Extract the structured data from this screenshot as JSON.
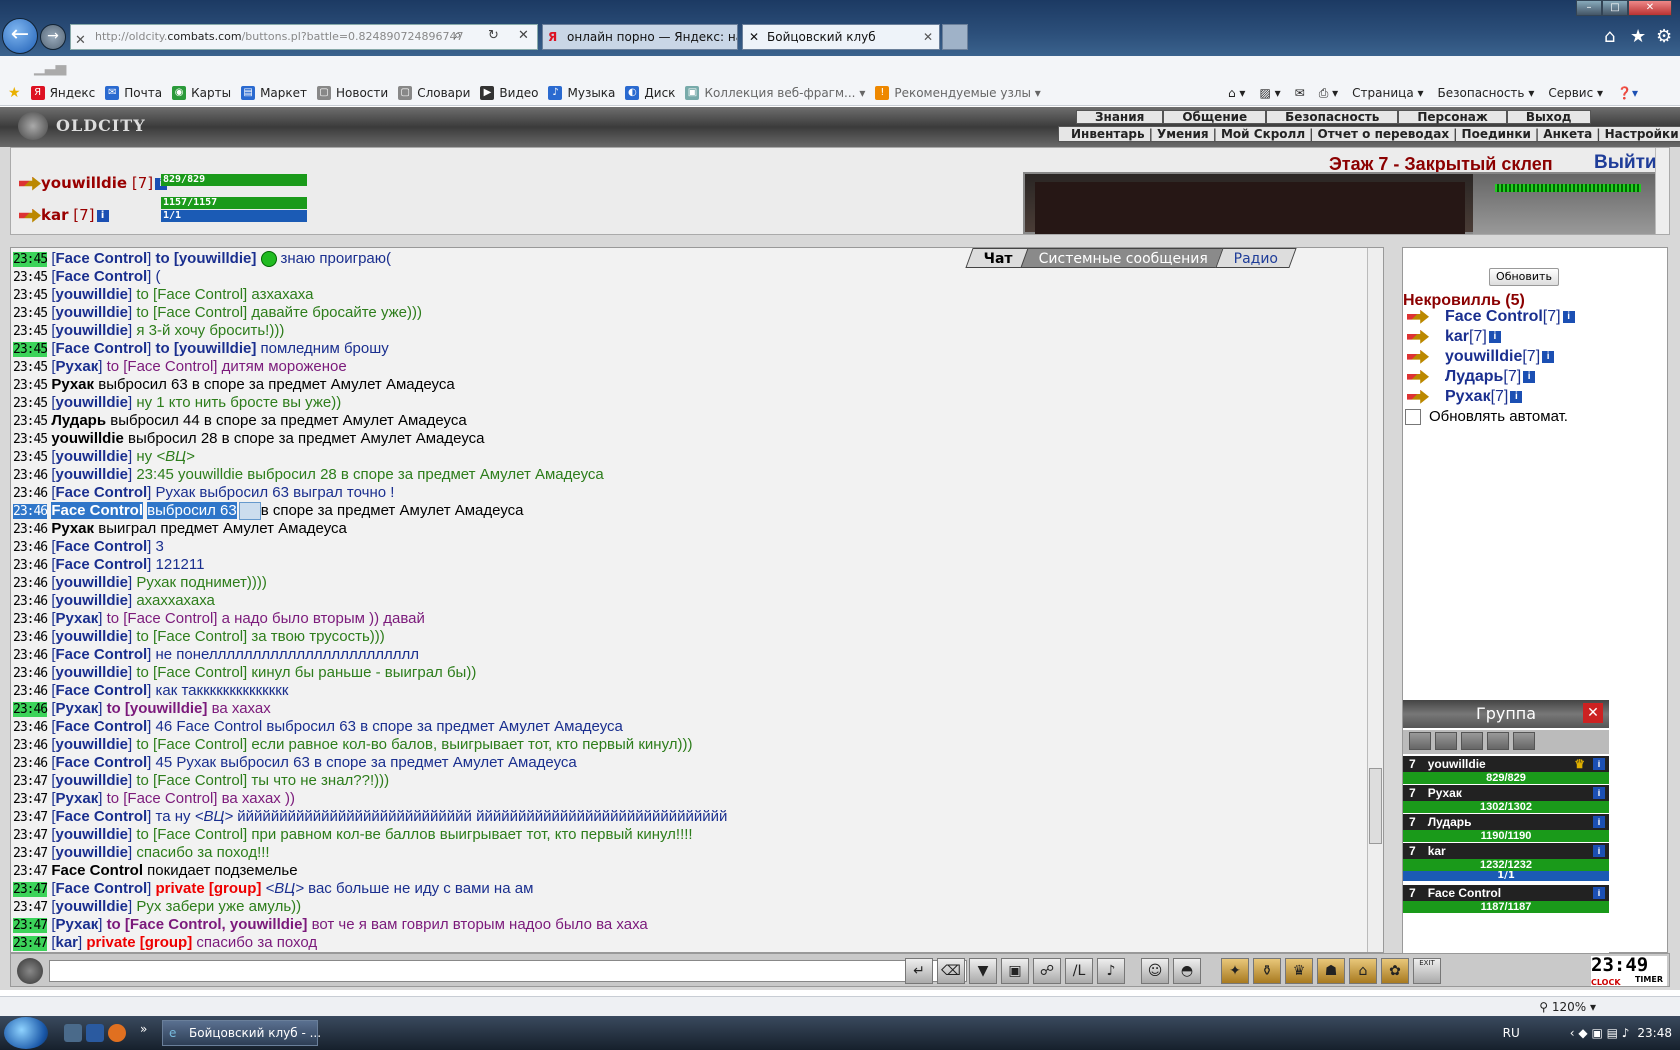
{
  "browser": {
    "url_prefix": "http://oldcity.",
    "url_domain": "combats.com",
    "url_rest": "/buttons.pl?battle=0.824890724896747",
    "tabs": [
      {
        "label": "онлайн порно — Яндекс: на..."
      },
      {
        "label": "Бойцовский клуб"
      }
    ],
    "favorites": [
      {
        "label": "Яндекс",
        "color": "#d12"
      },
      {
        "label": "Почта",
        "color": "#2a6ad0"
      },
      {
        "label": "Карты",
        "color": "#2a9a3a"
      },
      {
        "label": "Маркет",
        "color": "#2a6ad0"
      },
      {
        "label": "Новости",
        "color": "#888"
      },
      {
        "label": "Словари",
        "color": "#888"
      },
      {
        "label": "Видео",
        "color": "#333"
      },
      {
        "label": "Музыка",
        "color": "#2a6ad0"
      },
      {
        "label": "Диск",
        "color": "#2a6ad0"
      },
      {
        "label": "Коллекция веб-фрагм...",
        "color": "#7aa"
      },
      {
        "label": "Рекомендуемые узлы",
        "color": "#e80"
      }
    ],
    "commands": [
      "Страница ▾",
      "Безопасность ▾",
      "Сервис ▾"
    ],
    "zoom": "120%"
  },
  "game": {
    "logo": "OLDCITY",
    "menu_top": [
      "Знания",
      "Общение",
      "Безопасность",
      "Персонаж",
      "Выход"
    ],
    "menu_sub": [
      "Инвентарь",
      "Умения",
      "Мой Скролл",
      "Отчет о переводах",
      "Поединки",
      "Анкета",
      "Настройки"
    ],
    "location": "Этаж 7 - Закрытый склеп",
    "exit_label": "Выйти",
    "players": [
      {
        "name": "youwilldie",
        "level": "[7]",
        "hp": "829/829",
        "hp_fill": 1.0
      },
      {
        "name": "kar",
        "level": "[7]",
        "hp": "1157/1157",
        "hp_fill": 1.0,
        "mp": "1/1",
        "mp_fill": 1.0
      }
    ]
  },
  "chat": {
    "tabs": [
      "Чат",
      "Системные сообщения",
      "Радио"
    ],
    "lines": [
      {
        "time": "23:45",
        "hl": true,
        "nick": "Face Control",
        "to": "to [youwilldie]",
        "text": "знаю проиграю(",
        "cls": "msg-b",
        "icon": true
      },
      {
        "time": "23:45",
        "nick": "Face Control",
        "text": "(",
        "cls": "msg-b"
      },
      {
        "time": "23:45",
        "nick": "youwilldie",
        "to_plain": "to [Face Control]",
        "text": "азхахаха",
        "cls": "msg-g"
      },
      {
        "time": "23:45",
        "nick": "youwilldie",
        "to_plain": "to [Face Control]",
        "text": "давайте бросайте уже)))",
        "cls": "msg-g"
      },
      {
        "time": "23:45",
        "nick": "youwilldie",
        "text": "я 3-й хочу бросить!)))",
        "cls": "msg-g"
      },
      {
        "time": "23:45",
        "hl": true,
        "nick": "Face Control",
        "to": "to [youwilldie]",
        "text": "помледним брошу",
        "cls": "msg-b"
      },
      {
        "time": "23:45",
        "nick": "Рухак",
        "to_plain": "to [Face Control]",
        "text": "дитям мороженое",
        "cls": "msg-p"
      },
      {
        "time": "23:45",
        "sys": "Рухак",
        "text": "выбросил 63 в споре за предмет Амулет Амадеуса"
      },
      {
        "time": "23:45",
        "nick": "youwilldie",
        "text": "ну 1 кто нить бросте вы уже))",
        "cls": "msg-g"
      },
      {
        "time": "23:45",
        "sys": "Лударь",
        "text": "выбросил 44 в споре за предмет Амулет Амадеуса"
      },
      {
        "time": "23:45",
        "sys": "youwilldie",
        "text": "выбросил 28 в споре за предмет Амулет Амадеуса"
      },
      {
        "time": "23:45",
        "nick": "youwilldie",
        "text": "ну",
        "vc": "<ВЦ>",
        "cls": "msg-g"
      },
      {
        "time": "23:46",
        "nick": "youwilldie",
        "text": "23:45 youwilldie выбросил 28 в споре за предмет Амулет Амадеуса",
        "cls": "msg-g"
      },
      {
        "time": "23:46",
        "nick": "Face Control",
        "text": "Рухак выбросил 63 выграл точно !",
        "cls": "msg-b"
      },
      {
        "time": "23:46",
        "sel": true,
        "sys": "Face Control",
        "seltext": "выбросил 63",
        "text": "в споре за предмет Амулет Амадеуса"
      },
      {
        "time": "23:46",
        "sys": "Рухак",
        "text": "выиграл предмет Амулет Амадеуса"
      },
      {
        "time": "23:46",
        "nick": "Face Control",
        "text": "3",
        "cls": "msg-b"
      },
      {
        "time": "23:46",
        "nick": "Face Control",
        "text": "121211",
        "cls": "msg-b"
      },
      {
        "time": "23:46",
        "nick": "youwilldie",
        "text": "Рухак поднимет))))",
        "cls": "msg-g"
      },
      {
        "time": "23:46",
        "nick": "youwilldie",
        "text": "ахаххахаха",
        "cls": "msg-g"
      },
      {
        "time": "23:46",
        "nick": "Рухак",
        "to_plain": "to [Face Control]",
        "text": "а надо было вторым )) давай",
        "cls": "msg-p"
      },
      {
        "time": "23:46",
        "nick": "youwilldie",
        "to_plain": "to [Face Control]",
        "text": "за твою трусость)))",
        "cls": "msg-g"
      },
      {
        "time": "23:46",
        "nick": "Face Control",
        "text": "не понелллллллллллллллллллллллл",
        "cls": "msg-b"
      },
      {
        "time": "23:46",
        "nick": "youwilldie",
        "to_plain": "to [Face Control]",
        "text": "кинул бы раньше - выиграл бы))",
        "cls": "msg-g"
      },
      {
        "time": "23:46",
        "nick": "Face Control",
        "text": "как такккккккккккккк",
        "cls": "msg-b"
      },
      {
        "time": "23:46",
        "hl": true,
        "nick": "Рухак",
        "to": "to [youwilldie]",
        "text": "ва хахах",
        "cls": "msg-p"
      },
      {
        "time": "23:46",
        "nick": "Face Control",
        "text": "46 Face Control выбросил 63 в споре за предмет Амулет Амадеуса",
        "cls": "msg-b"
      },
      {
        "time": "23:46",
        "nick": "youwilldie",
        "to_plain": "to [Face Control]",
        "text": "если равное кол-во балов, выигрывает тот, кто первый кинул)))",
        "cls": "msg-g"
      },
      {
        "time": "23:46",
        "nick": "Face Control",
        "text": "45 Рухак выбросил 63 в споре за предмет Амулет Амадеуса",
        "cls": "msg-b"
      },
      {
        "time": "23:47",
        "nick": "youwilldie",
        "to_plain": "to [Face Control]",
        "text": "ты что не знал??!)))",
        "cls": "msg-g"
      },
      {
        "time": "23:47",
        "nick": "Рухак",
        "to_plain": "to [Face Control]",
        "text": "ва хахах ))",
        "cls": "msg-p"
      },
      {
        "time": "23:47",
        "nick": "Face Control",
        "text": "та ну",
        "vc": "<ВЦ>",
        "text2": "йййййййййййййййййййййййййййй йййййййййййййййййййййййййййййй",
        "cls": "msg-b"
      },
      {
        "time": "23:47",
        "nick": "youwilldie",
        "to_plain": "to [Face Control]",
        "text": "при равном кол-ве баллов выигрывает тот, кто первый кинул!!!!",
        "cls": "msg-g"
      },
      {
        "time": "23:47",
        "nick": "youwilldie",
        "text": "спасибо за поход!!!",
        "cls": "msg-g"
      },
      {
        "time": "23:47",
        "sys": "Face Control",
        "text": "покидает подземелье"
      },
      {
        "time": "23:47",
        "hl": true,
        "nick": "Face Control",
        "priv": "private [group]",
        "vc": "<ВЦ>",
        "text2": "вас больше не иду с вами на ам",
        "cls": "msg-b"
      },
      {
        "time": "23:47",
        "nick": "youwilldie",
        "text": "Рух забери уже амуль))",
        "cls": "msg-g"
      },
      {
        "time": "23:47",
        "hl": true,
        "nick": "Рухак",
        "to": "to [Face Control, youwilldie]",
        "text": "вот че я вам говрил вторым надоо было ва хаха",
        "cls": "msg-p"
      },
      {
        "time": "23:47",
        "hl": true,
        "nick": "kar",
        "priv": "private [group]",
        "text": "спасибо за поход",
        "cls": "msg-p"
      }
    ]
  },
  "room": {
    "refresh_label": "Обновить",
    "title": "Некровилль (5)",
    "members": [
      {
        "name": "Face Control",
        "level": "[7]"
      },
      {
        "name": "kar",
        "level": "[7]"
      },
      {
        "name": "youwilldie",
        "level": "[7]"
      },
      {
        "name": "Лударь",
        "level": "[7]"
      },
      {
        "name": "Рухак",
        "level": "[7]"
      }
    ],
    "auto_label": "Обновлять автомат."
  },
  "group": {
    "title": "Группа",
    "members": [
      {
        "level": "7",
        "name": "youwilldie",
        "hp": "829/829",
        "leader": true
      },
      {
        "level": "7",
        "name": "Рухак",
        "hp": "1302/1302"
      },
      {
        "level": "7",
        "name": "Лударь",
        "hp": "1190/1190"
      },
      {
        "level": "7",
        "name": "kar",
        "hp": "1232/1232",
        "mp": "1/1"
      },
      {
        "level": "7",
        "name": "Face Control",
        "hp": "1187/1187"
      }
    ]
  },
  "clock": {
    "time": "23:49",
    "clock_label": "CLOCK",
    "timer_label": "TIMER",
    "exit_label": "EXIT"
  },
  "taskbar": {
    "item": "Бойцовский клуб - ...",
    "lang": "RU",
    "time": "23:48"
  }
}
